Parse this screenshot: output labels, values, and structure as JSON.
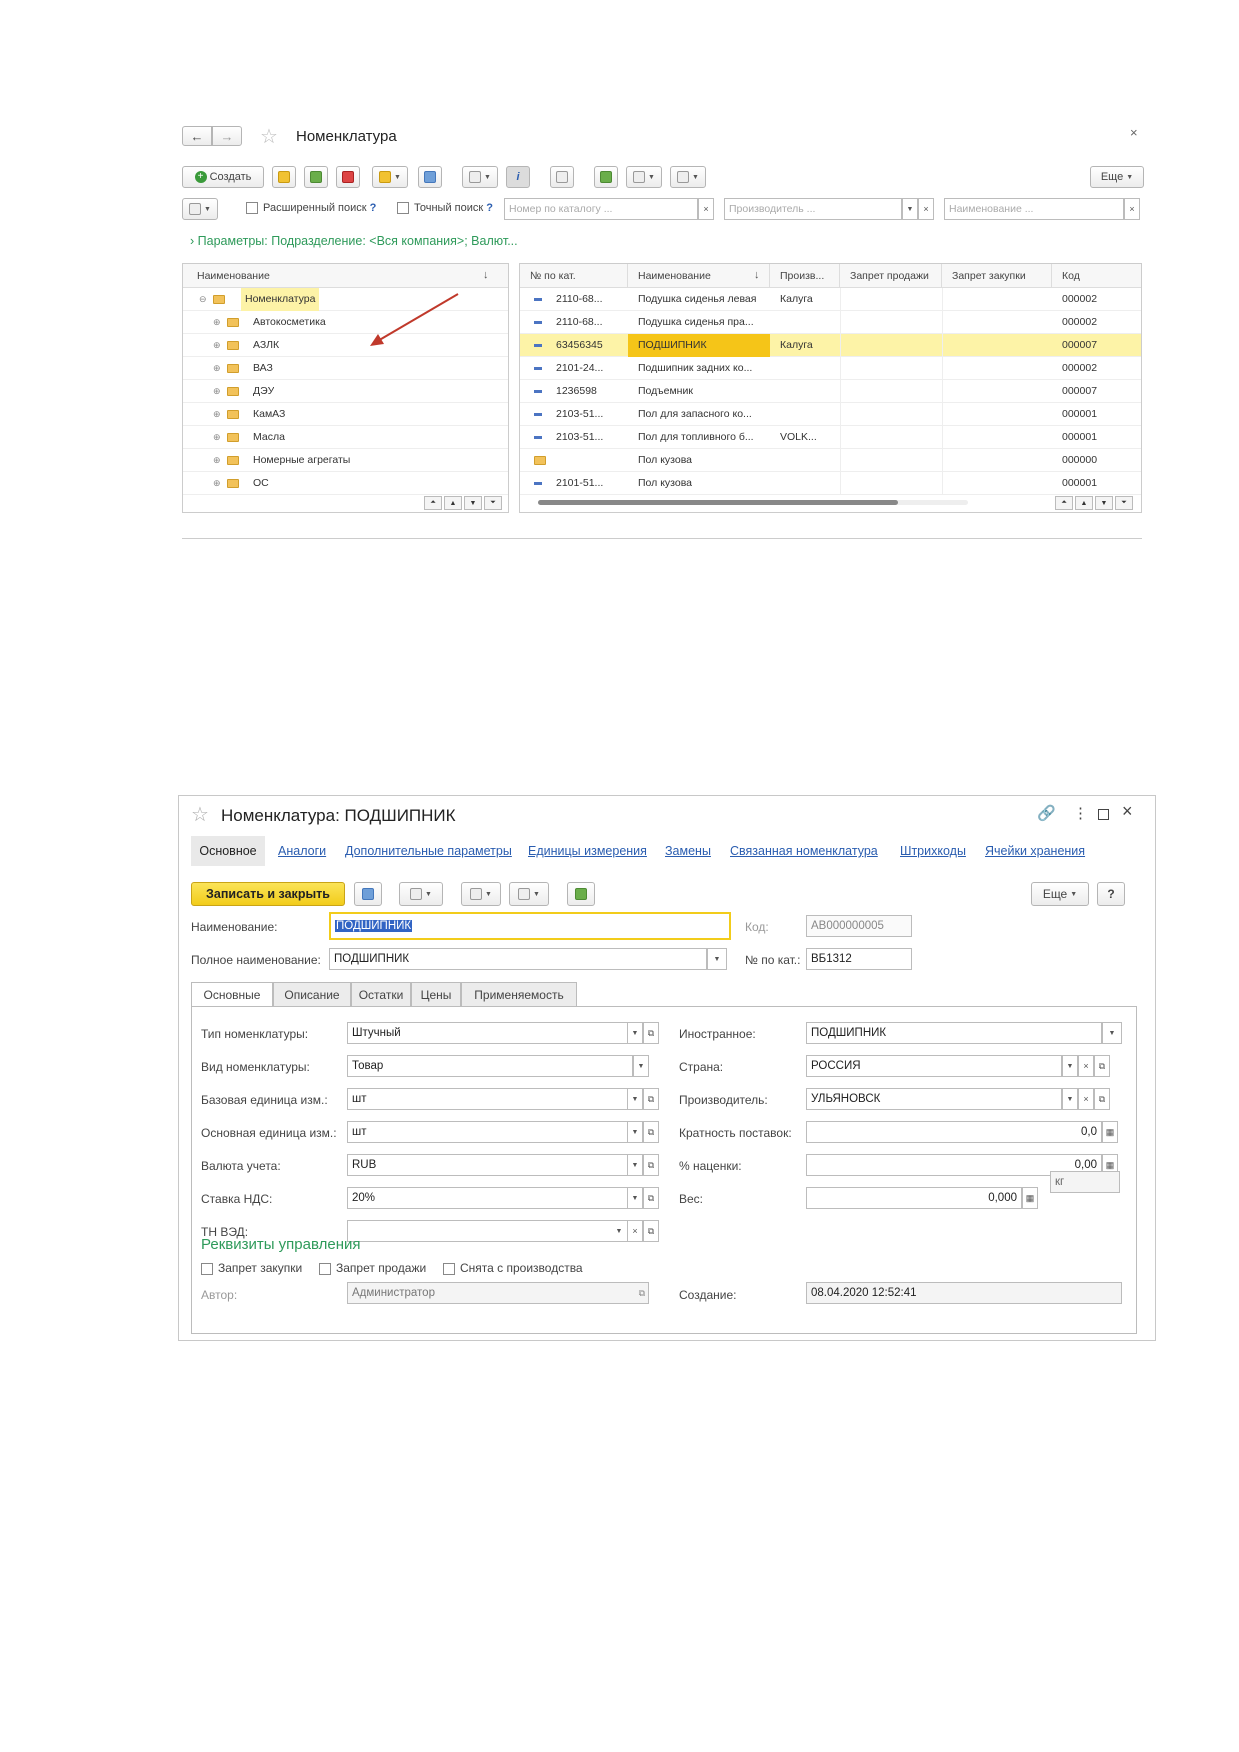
{
  "list_window": {
    "title": "Номенклатура",
    "close": "×",
    "toolbar": {
      "create": "Создать",
      "more": "Еще"
    },
    "search": {
      "extended": "Расширенный поиск",
      "exact": "Точный поиск",
      "help": "?",
      "catalog_placeholder": "Номер по каталогу ...",
      "manufacturer_placeholder": "Производитель ...",
      "name_placeholder": "Наименование ...",
      "clear": "×"
    },
    "params": "Параметры: Подразделение: <Вся компания>; Валют...",
    "tree": {
      "header": "Наименование",
      "sort": "↓",
      "root": "Номенклатура",
      "items": [
        "Автокосметика",
        "АЗЛК",
        "ВАЗ",
        "ДЭУ",
        "КамАЗ",
        "Масла",
        "Номерные агрегаты",
        "ОС"
      ]
    },
    "table": {
      "headers": [
        "№ по кат.",
        "Наименование",
        "Произв...",
        "Запрет продажи",
        "Запрет закупки",
        "Код"
      ],
      "sort": "↓",
      "rows": [
        {
          "cat": "2110-68...",
          "name": "Подушка сиденья левая",
          "man": "Калуга",
          "code": "000002"
        },
        {
          "cat": "2110-68...",
          "name": "Подушка сиденья пра...",
          "man": "",
          "code": "000002"
        },
        {
          "cat": "63456345",
          "name": "ПОДШИПНИК",
          "man": "Калуга",
          "code": "000007"
        },
        {
          "cat": "2101-24...",
          "name": "Подшипник задних ко...",
          "man": "",
          "code": "000002"
        },
        {
          "cat": "1236598",
          "name": "Подъемник",
          "man": "",
          "code": "000007"
        },
        {
          "cat": "2103-51...",
          "name": "Пол для запасного ко...",
          "man": "",
          "code": "000001"
        },
        {
          "cat": "2103-51...",
          "name": "Пол для топливного б...",
          "man": "VOLK...",
          "code": "000001"
        },
        {
          "cat": "",
          "name": "Пол кузова",
          "man": "",
          "code": "000000"
        },
        {
          "cat": "2101-51...",
          "name": "Пол кузова",
          "man": "",
          "code": "000001"
        }
      ]
    }
  },
  "form": {
    "title": "Номенклатура: ПОДШИПНИК",
    "top_tabs": [
      "Основное",
      "Аналоги",
      "Дополнительные параметры",
      "Единицы измерения",
      "Замены",
      "Связанная номенклатура",
      "Штрихкоды",
      "Ячейки хранения"
    ],
    "save_close": "Записать и закрыть",
    "more": "Еще",
    "help": "?",
    "name_label": "Наименование:",
    "name_value": "ПОДШИПНИК",
    "code_label": "Код:",
    "code_value": "АВ000000005",
    "fullname_label": "Полное наименование:",
    "fullname_value": "ПОДШИПНИК",
    "catno_label": "№ по кат.:",
    "catno_value": "ВБ1312",
    "inner_tabs": [
      "Основные",
      "Описание",
      "Остатки",
      "Цены",
      "Применяемость"
    ],
    "left_fields": [
      {
        "label": "Тип номенклатуры:",
        "value": "Штучный"
      },
      {
        "label": "Вид номенклатуры:",
        "value": "Товар"
      },
      {
        "label": "Базовая единица изм.:",
        "value": "шт"
      },
      {
        "label": "Основная единица изм.:",
        "value": "шт"
      },
      {
        "label": "Валюта учета:",
        "value": "RUB"
      },
      {
        "label": "Ставка НДС:",
        "value": "20%"
      },
      {
        "label": "ТН ВЭД:",
        "value": ""
      }
    ],
    "right_fields": [
      {
        "label": "Иностранное:",
        "value": "ПОДШИПНИК"
      },
      {
        "label": "Страна:",
        "value": "РОССИЯ"
      },
      {
        "label": "Производитель:",
        "value": "УЛЬЯНОВСК"
      },
      {
        "label": "Кратность поставок:",
        "value": "0,0"
      },
      {
        "label": "% наценки:",
        "value": "0,00"
      },
      {
        "label": "Вес:",
        "value": "0,000"
      }
    ],
    "weight_unit": "кг",
    "management_header": "Реквизиты управления",
    "checkboxes": [
      "Запрет закупки",
      "Запрет продажи",
      "Снята с производства"
    ],
    "author_label": "Автор:",
    "author_value": "Администратор",
    "created_label": "Создание:",
    "created_value": "08.04.2020 12:52:41"
  }
}
